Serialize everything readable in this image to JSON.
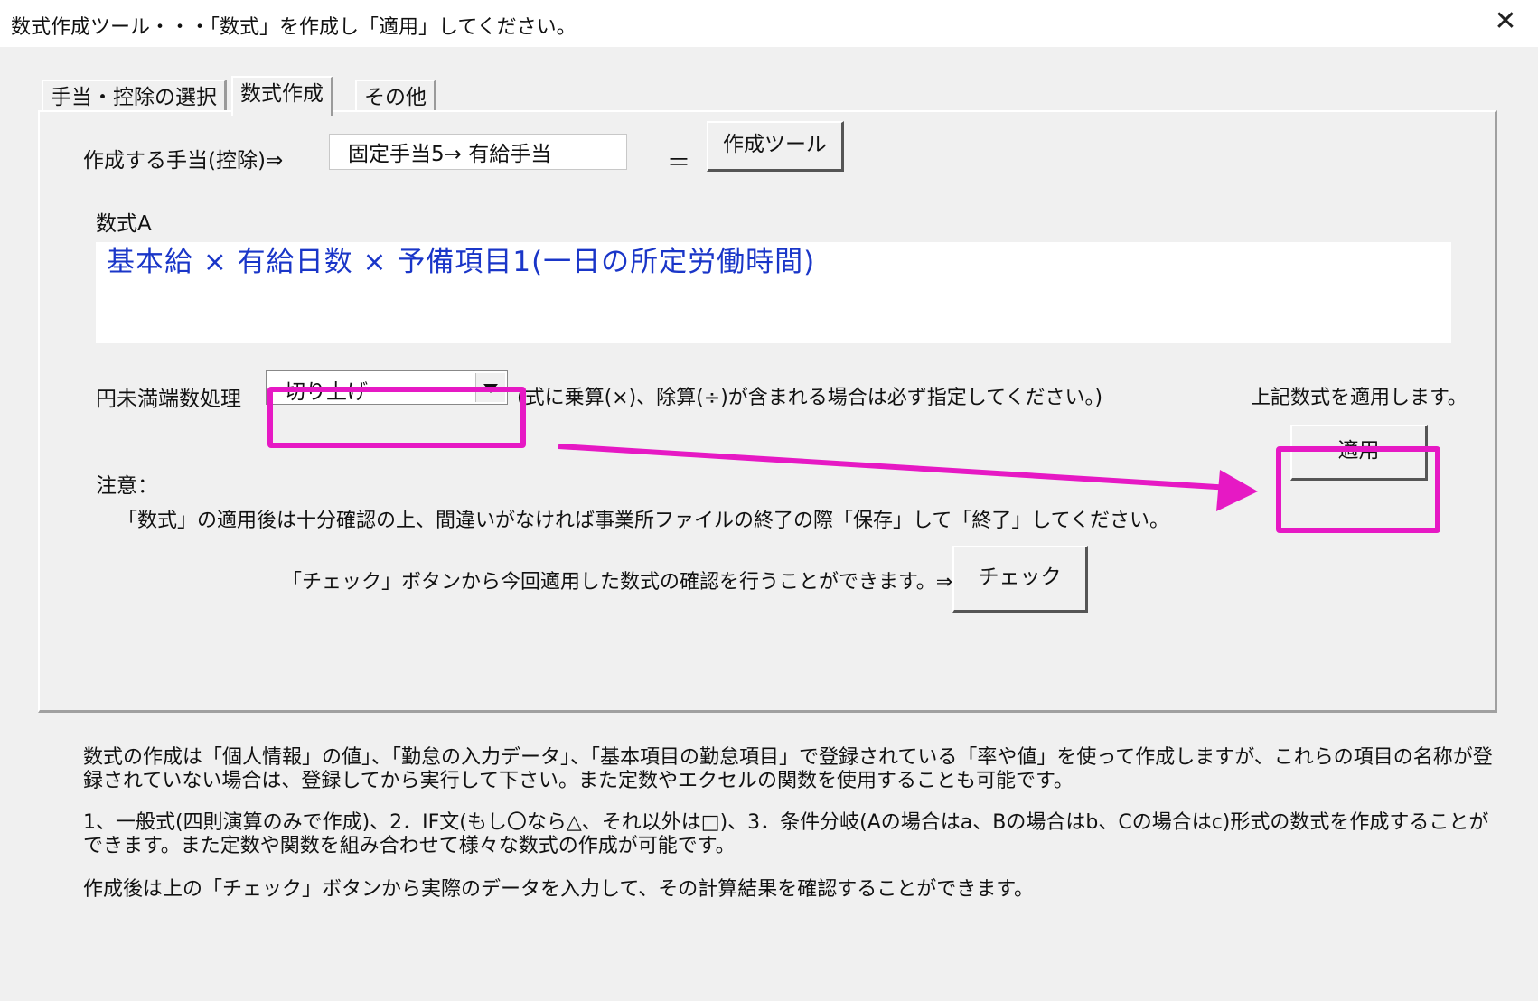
{
  "window": {
    "title": "数式作成ツール・・・「数式」を作成し「適用」してください。",
    "close_glyph": "✕"
  },
  "tabs": [
    {
      "label": "手当・控除の選択"
    },
    {
      "label": "数式作成"
    },
    {
      "label": "その他"
    }
  ],
  "form": {
    "target_label": "作成する手当(控除)⇒",
    "target_value": "固定手当5→ 有給手当",
    "equals": "＝",
    "create_tool_button": "作成ツール",
    "formula_label": "数式A",
    "formula_value": "基本給 × 有給日数 × 予備項目1(一日の所定労働時間)",
    "rounding_label": "円未満端数処理",
    "rounding_selected": "切り上げ",
    "rounding_note": "(式に乗算(×)、除算(÷)が含まれる場合は必ず指定してください。)",
    "apply_caption": "上記数式を適用します。",
    "apply_button": "適用",
    "caution_heading": "注意：",
    "caution_text": "「数式」の適用後は十分確認の上、間違いがなければ事業所ファイルの終了の際「保存」して「終了」してください。",
    "check_caption": "「チェック」ボタンから今回適用した数式の確認を行うことができます。⇒",
    "check_button": "チェック"
  },
  "info": {
    "p1": "数式の作成は「個人情報」の値」、「勤怠の入力データ」、「基本項目の勤怠項目」で登録されている「率や値」を使って作成しますが、これらの項目の名称が登録されていない場合は、登録してから実行して下さい。また定数やエクセルの関数を使用することも可能です。",
    "p2": "1、一般式(四則演算のみで作成)、2．IF文(もし〇なら△、それ以外は□)、3．条件分岐(Aの場合はa、Bの場合はb、Cの場合はc)形式の数式を作成することができます。また定数や関数を組み合わせて様々な数式の作成が可能です。",
    "p3": "作成後は上の「チェック」ボタンから実際のデータを入力して、その計算結果を確認することができます。"
  },
  "colors": {
    "highlight": "#e619c4",
    "formula_text": "#1a36c8"
  }
}
